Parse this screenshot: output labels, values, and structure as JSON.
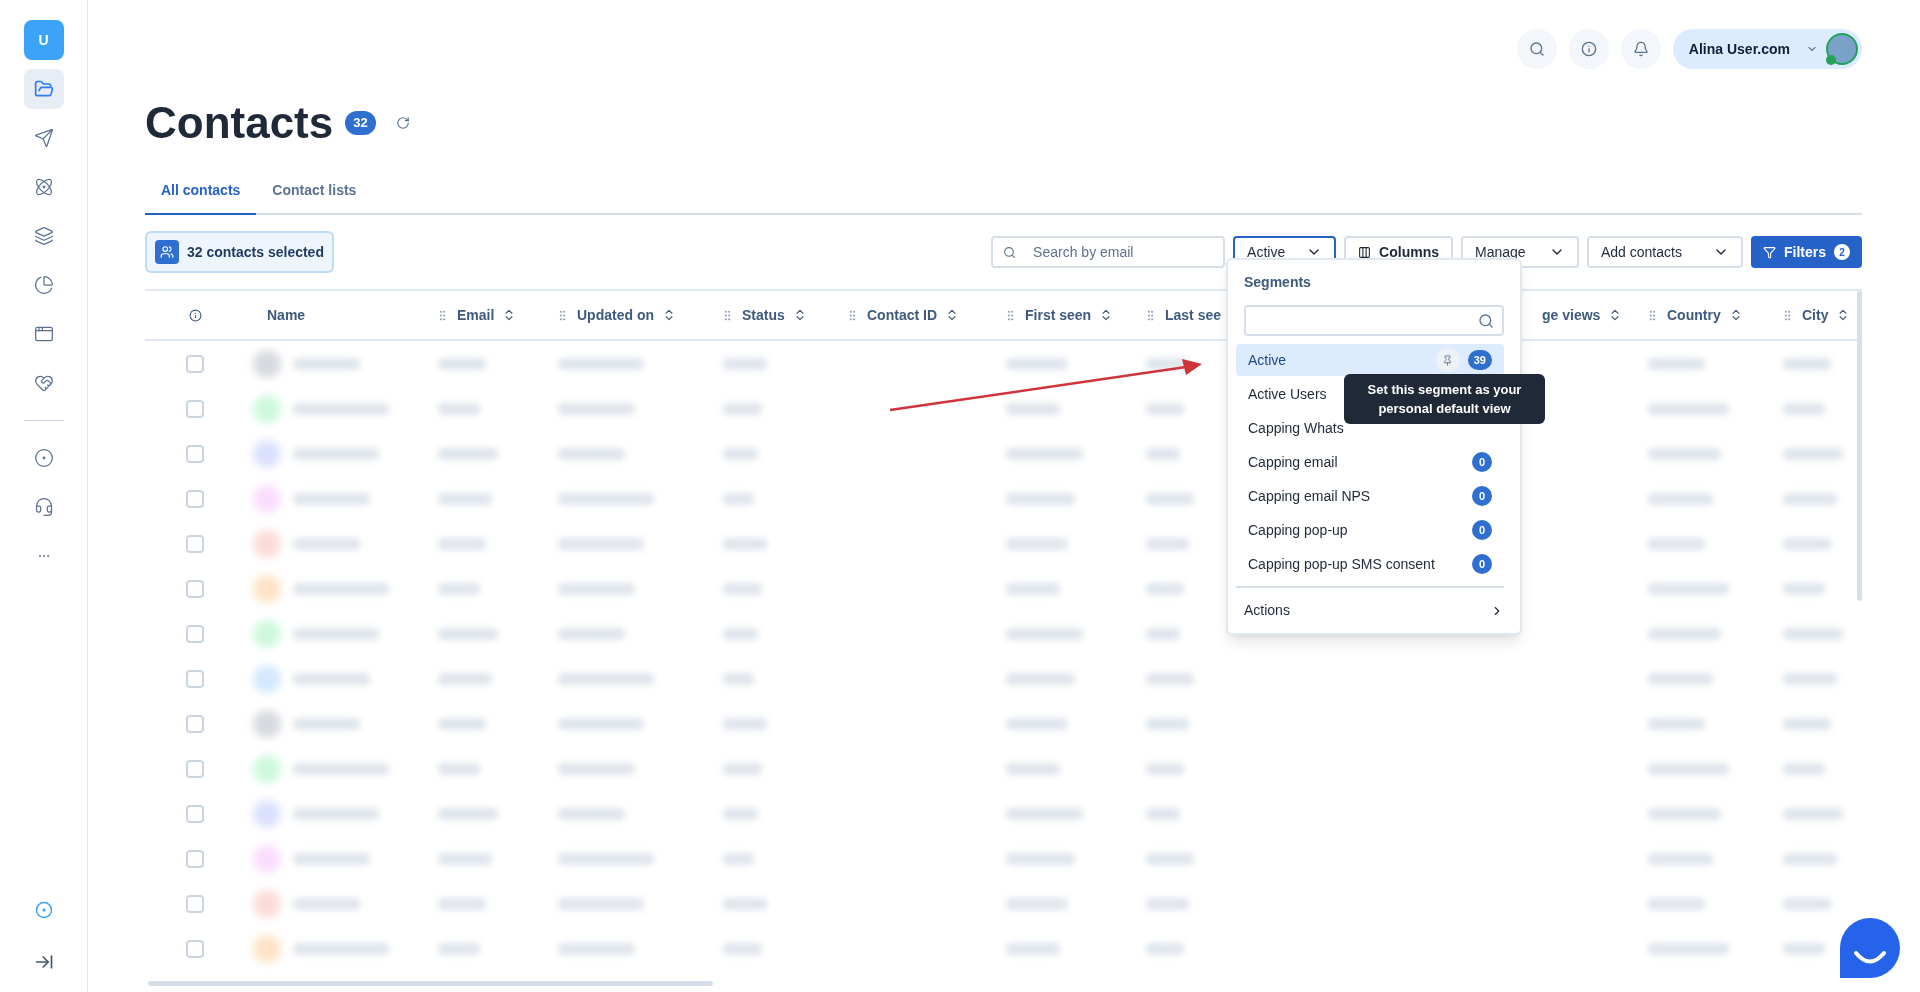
{
  "sidebar": {
    "logo": "U",
    "items": [
      {
        "kind": "folder",
        "selected": true
      },
      {
        "kind": "send",
        "selected": false
      },
      {
        "kind": "atom",
        "selected": false
      },
      {
        "kind": "layers",
        "selected": false
      },
      {
        "kind": "chart",
        "selected": false
      },
      {
        "kind": "window",
        "selected": false
      },
      {
        "kind": "heart",
        "selected": false
      }
    ],
    "tools": [
      {
        "kind": "circles"
      },
      {
        "kind": "headset"
      },
      {
        "kind": "more"
      }
    ]
  },
  "header": {
    "user": "Alina User.com",
    "online": true
  },
  "page": {
    "title": "Contacts",
    "count": "32"
  },
  "tabs": [
    {
      "label": "All contacts",
      "selected": true
    },
    {
      "label": "Contact lists",
      "selected": false
    }
  ],
  "selection": {
    "label": "32 contacts selected"
  },
  "toolbar": {
    "search": {
      "placeholder": "Search by email"
    },
    "segment": "Active",
    "columns": "Columns",
    "manage": "Manage",
    "add": "Add contacts",
    "filters": "Filters",
    "filters_count": "2"
  },
  "table": {
    "columns": [
      {
        "label": "Name",
        "kind": "plain"
      },
      {
        "label": "Email",
        "kind": "movable_sortable"
      },
      {
        "label": "Updated on",
        "kind": "movable_sortable"
      },
      {
        "label": "Status",
        "kind": "movable_sortable"
      },
      {
        "label": "Contact ID",
        "kind": "movable_sortable"
      },
      {
        "label": "First seen",
        "kind": "movable_sortable"
      },
      {
        "label": "Last see",
        "kind": "movable"
      },
      {
        "label": "ge views",
        "kind": "sortable"
      },
      {
        "label": "Country",
        "kind": "movable_sortable"
      },
      {
        "label": "City",
        "kind": "movable_sortable"
      }
    ],
    "rows": [
      {
        "checked": false
      },
      {
        "checked": false
      },
      {
        "checked": false
      },
      {
        "checked": false
      },
      {
        "checked": false
      },
      {
        "checked": false
      },
      {
        "checked": false
      },
      {
        "checked": false
      },
      {
        "checked": false
      },
      {
        "checked": false
      },
      {
        "checked": false
      },
      {
        "checked": false
      },
      {
        "checked": false
      },
      {
        "checked": false
      }
    ]
  },
  "dropdown": {
    "heading": "Segments",
    "items": [
      {
        "label": "Active",
        "count": "39",
        "selected": true,
        "pin": true
      },
      {
        "label": "Active Users",
        "selected": false,
        "pin": false
      },
      {
        "label": "Capping Whats",
        "selected": false,
        "pin": false
      },
      {
        "label": "Capping email",
        "count": "0",
        "selected": false,
        "pin": false
      },
      {
        "label": "Capping email NPS",
        "count": "0",
        "selected": false,
        "pin": false
      },
      {
        "label": "Capping pop-up",
        "count": "0",
        "selected": false,
        "pin": false
      },
      {
        "label": "Capping pop-up SMS consent",
        "count": "0",
        "selected": false,
        "pin": false
      }
    ],
    "actions": "Actions"
  },
  "tooltip": "Set this segment as your personal default view"
}
